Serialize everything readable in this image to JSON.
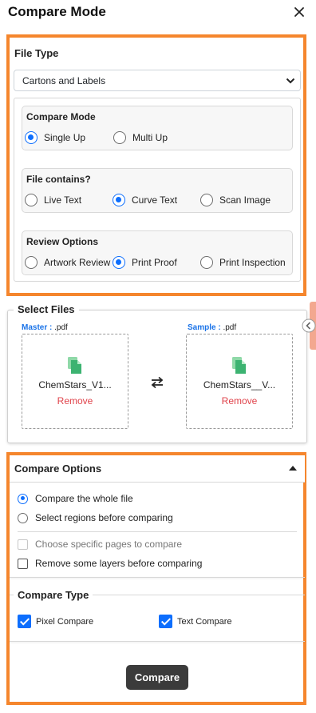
{
  "header": {
    "title": "Compare Mode"
  },
  "file_type": {
    "title": "File Type",
    "selected": "Cartons and Labels",
    "compare_mode": {
      "title": "Compare Mode",
      "options": [
        "Single Up",
        "Multi Up"
      ],
      "selected": "Single Up"
    },
    "file_contains": {
      "title": "File contains?",
      "options": [
        "Live Text",
        "Curve Text",
        "Scan Image"
      ],
      "selected": "Curve Text"
    },
    "review_options": {
      "title": "Review Options",
      "options": [
        "Artwork Review",
        "Print Proof",
        "Print Inspection"
      ],
      "selected": "Print Proof"
    }
  },
  "select_files": {
    "title": "Select Files",
    "master": {
      "label": "Master :",
      "ext": " .pdf",
      "file_name": "ChemStars_V1...",
      "remove": "Remove"
    },
    "sample": {
      "label": "Sample :",
      "ext": " .pdf",
      "file_name": "ChemStars__V...",
      "remove": "Remove"
    }
  },
  "compare_options": {
    "title": "Compare Options",
    "scope_options": [
      "Compare the whole file",
      "Select regions before comparing"
    ],
    "scope_selected": "Compare the whole file",
    "specific_pages": {
      "label": "Choose specific pages to compare",
      "checked": false,
      "disabled": true
    },
    "remove_layers": {
      "label": "Remove some layers before comparing",
      "checked": false
    }
  },
  "compare_type": {
    "title": "Compare Type",
    "pixel": {
      "label": "Pixel Compare",
      "checked": true
    },
    "text": {
      "label": "Text Compare",
      "checked": true
    }
  },
  "compare_button": "Compare",
  "colors": {
    "accent": "#f5862d",
    "primary": "#0d6efd",
    "remove": "#e0434b",
    "file_icon": "#3cb371",
    "button": "#3b3b3b"
  }
}
